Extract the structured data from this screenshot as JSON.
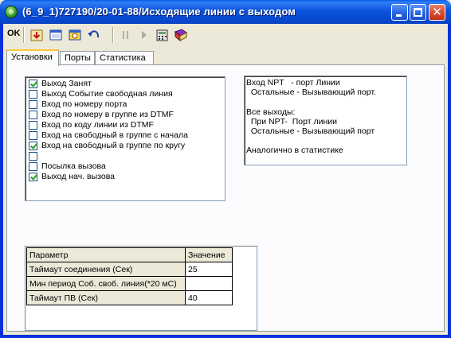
{
  "window": {
    "title": "(6_9_1)727190/20-01-88/Исходящие линии с выходом"
  },
  "toolbar": {
    "ok_label": "OK",
    "tools": [
      "download-icon",
      "window-icon",
      "clock-icon",
      "undo-icon",
      "pause-icon",
      "play-icon",
      "calculator-icon",
      "book-icon"
    ]
  },
  "tabs": [
    {
      "label": "Установки",
      "active": true
    },
    {
      "label": "Порты",
      "active": false
    },
    {
      "label": "Статистика",
      "active": false
    }
  ],
  "options": [
    {
      "label": "Выход Занят",
      "checked": true
    },
    {
      "label": "Выход Событие свободная линия",
      "checked": false
    },
    {
      "label": "Вход по номеру порта",
      "checked": false
    },
    {
      "label": "Вход по номеру  в группе из DTMF",
      "checked": false
    },
    {
      "label": "Вход по коду линии из DTMF",
      "checked": false
    },
    {
      "label": "Вход на свободный в группе с начала",
      "checked": false
    },
    {
      "label": "Вход на свободный в группе по кругу",
      "checked": true
    },
    {
      "label": "",
      "checked": false
    },
    {
      "label": "Посылка вызова",
      "checked": false
    },
    {
      "label": "Выход нач. вызова",
      "checked": true
    }
  ],
  "note": {
    "lines": [
      "Вход NPT   - порт Линии",
      "  Остальные - Вызывающий порт.",
      "",
      "Все выходы:",
      "  При NPT-  Порт линии",
      "  Остальные - Вызывающий порт",
      "",
      "Аналогично в статистике"
    ]
  },
  "params": {
    "header_param": "Параметр",
    "header_value": "Значение",
    "rows": [
      {
        "name": "Таймаут соединения (Сек)",
        "value": "25"
      },
      {
        "name": "Мин период Соб. своб. линия(*20 мС)",
        "value": ""
      },
      {
        "name": "Таймаут ПВ (Сек)",
        "value": "40"
      }
    ]
  }
}
